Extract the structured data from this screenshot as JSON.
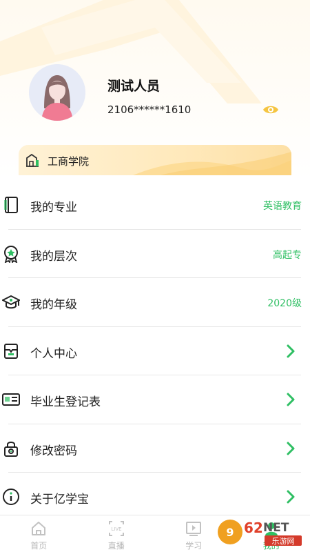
{
  "profile": {
    "name": "测试人员",
    "id": "2106******1610",
    "college": "工商学院"
  },
  "menu": [
    {
      "label": "我的专业",
      "value": "英语教育",
      "icon": "book-icon"
    },
    {
      "label": "我的层次",
      "value": "高起专",
      "icon": "badge-icon"
    },
    {
      "label": "我的年级",
      "value": "2020级",
      "icon": "graduation-cap-icon"
    },
    {
      "label": "个人中心",
      "value": "",
      "icon": "folder-icon"
    },
    {
      "label": "毕业生登记表",
      "value": "",
      "icon": "id-card-icon"
    },
    {
      "label": "修改密码",
      "value": "",
      "icon": "lock-icon"
    },
    {
      "label": "关于亿学宝",
      "value": "",
      "icon": "info-icon"
    }
  ],
  "tabbar": [
    {
      "label": "首页",
      "icon": "home-icon"
    },
    {
      "label": "直播",
      "icon": "live-icon"
    },
    {
      "label": "学习",
      "icon": "play-icon"
    },
    {
      "label": "我的",
      "icon": "user-icon"
    }
  ],
  "colors": {
    "accent": "#2fbf63",
    "eye": "#f5c542",
    "card": "#ffe9bb"
  },
  "watermark": {
    "text": "962.NET",
    "sub": "乐游网"
  }
}
